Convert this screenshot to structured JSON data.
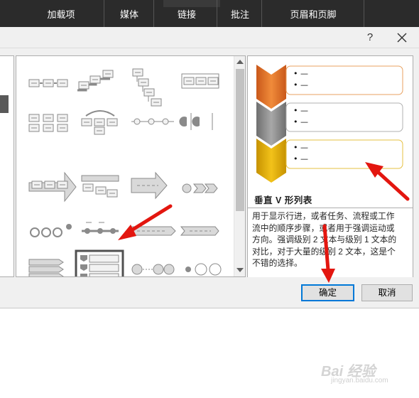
{
  "ribbon": {
    "tabs": [
      "加载项",
      "媒体",
      "链接",
      "批注",
      "页眉和页脚"
    ]
  },
  "dialog": {
    "help_label": "?",
    "preview": {
      "bullet_text": "• —",
      "title": "垂直 V 形列表",
      "description": "用于显示行进，或者任务、流程或工作\n流中的顺序步骤，或者用于强调运动或\n方向。强调级别 2 文本与级别 1 文本的\n对比，对于大量的级别 2 文本，这是个\n不错的选择。",
      "colors": [
        "#e87722",
        "#8c8c8c",
        "#d6a400"
      ]
    },
    "ok_label": "确定",
    "cancel_label": "取消"
  },
  "watermark": {
    "text": "Bai 经验",
    "sub": "jingyan.baidu.com"
  },
  "accent": {
    "arrow": "#e3160f",
    "focus": "#0078d7"
  }
}
